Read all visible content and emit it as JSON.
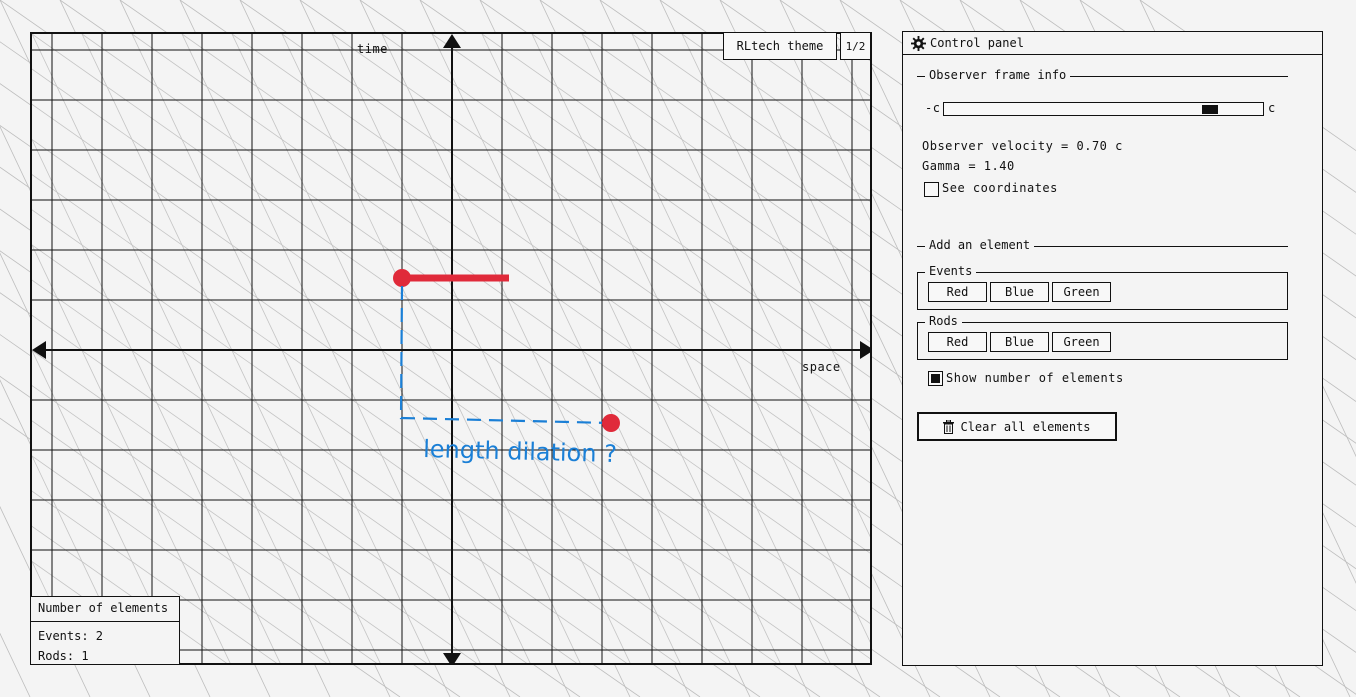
{
  "colors": {
    "red": "#e02a3a",
    "blue": "#1a7fd6",
    "grid": "#111111",
    "hatch": "#bdbdbd"
  },
  "plot": {
    "time_label": "time",
    "space_label": "space",
    "annotation": "length dilation ?"
  },
  "toolbar": {
    "theme_label": "RLtech theme",
    "page_label": "1/2"
  },
  "counts": {
    "title": "Number of elements",
    "events": "Events: 2",
    "rods": "Rods: 1"
  },
  "panel": {
    "title": "Control panel",
    "observer_section": "Observer frame info",
    "slider_min": "-c",
    "slider_max": "c",
    "slider_value": 0.7,
    "velocity_text": "Observer velocity = 0.70 c",
    "gamma_text": "Gamma = 1.40",
    "see_coords_label": "See coordinates",
    "see_coords_checked": false,
    "add_section": "Add an element",
    "events_group": "Events",
    "rods_group": "Rods",
    "event_buttons": [
      "Red",
      "Blue",
      "Green"
    ],
    "rod_buttons": [
      "Red",
      "Blue",
      "Green"
    ],
    "show_number_label": "Show number of elements",
    "show_number_checked": true,
    "clear_label": "Clear all elements"
  },
  "icons": {
    "panel": "gear-icon",
    "clear": "trash-icon"
  }
}
